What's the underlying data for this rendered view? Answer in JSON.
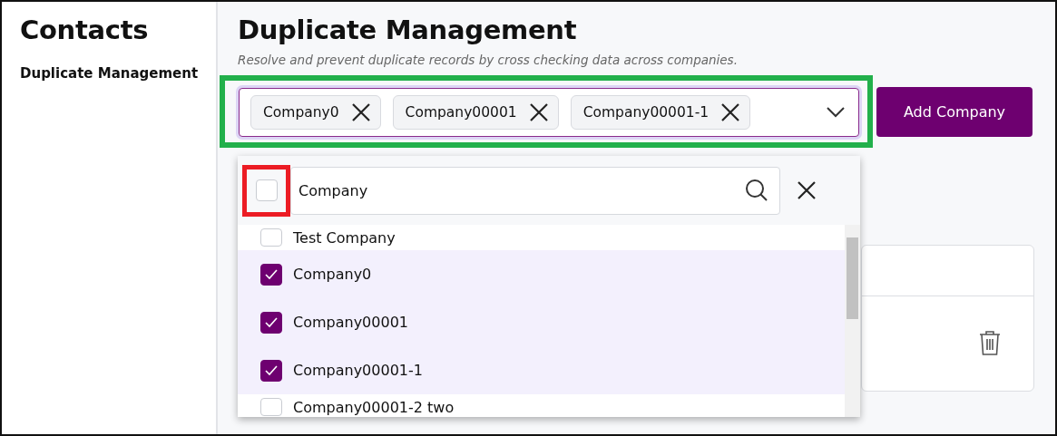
{
  "sidebar": {
    "title": "Contacts",
    "items": [
      {
        "label": "Duplicate Management",
        "selected": true
      }
    ]
  },
  "page": {
    "title": "Duplicate Management",
    "subtitle": "Resolve and prevent duplicate records by cross checking data across companies."
  },
  "company_select": {
    "chips": [
      "Company0",
      "Company00001",
      "Company00001-1"
    ],
    "expanded": true,
    "highlighted": true
  },
  "add_button": "Add Company",
  "dropdown": {
    "select_all": {
      "checked": false,
      "highlighted": true
    },
    "search": {
      "value": "Company"
    },
    "options": [
      {
        "label": "Test Company",
        "checked": false
      },
      {
        "label": "Company0",
        "checked": true
      },
      {
        "label": "Company00001",
        "checked": true
      },
      {
        "label": "Company00001-1",
        "checked": true
      },
      {
        "label": "Company00001-2 two",
        "checked": false
      }
    ]
  }
}
